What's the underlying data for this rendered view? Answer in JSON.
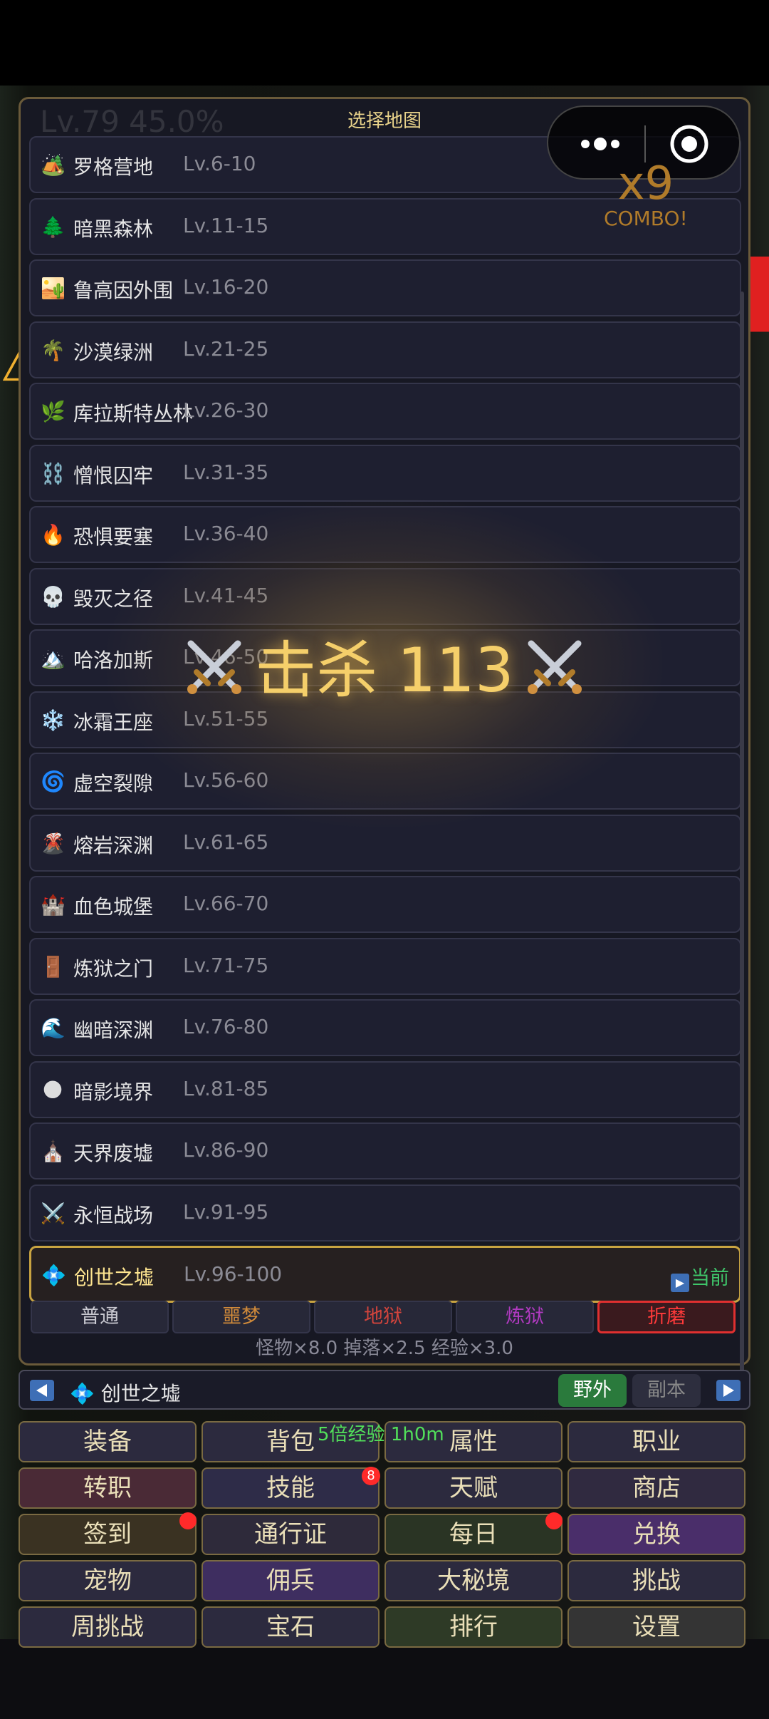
{
  "overlay": {
    "faint_level": "Lv.79 45.0%",
    "combo_count": "x9",
    "combo_label": "COMBO!",
    "kill_banner": "击杀 113"
  },
  "panel": {
    "title": "选择地图",
    "maps": [
      {
        "icon": "🏕️",
        "name": "罗格营地",
        "level": "Lv.6-10"
      },
      {
        "icon": "🌲",
        "name": "暗黑森林",
        "level": "Lv.11-15"
      },
      {
        "icon": "🏜️",
        "name": "鲁高因外围",
        "level": "Lv.16-20"
      },
      {
        "icon": "🌴",
        "name": "沙漠绿洲",
        "level": "Lv.21-25"
      },
      {
        "icon": "🌿",
        "name": "库拉斯特丛林",
        "level": "Lv.26-30"
      },
      {
        "icon": "⛓️",
        "name": "憎恨囚牢",
        "level": "Lv.31-35"
      },
      {
        "icon": "🔥",
        "name": "恐惧要塞",
        "level": "Lv.36-40"
      },
      {
        "icon": "💀",
        "name": "毁灭之径",
        "level": "Lv.41-45"
      },
      {
        "icon": "🏔️",
        "name": "哈洛加斯",
        "level": "Lv.46-50"
      },
      {
        "icon": "❄️",
        "name": "冰霜王座",
        "level": "Lv.51-55"
      },
      {
        "icon": "🌀",
        "name": "虚空裂隙",
        "level": "Lv.56-60"
      },
      {
        "icon": "🌋",
        "name": "熔岩深渊",
        "level": "Lv.61-65"
      },
      {
        "icon": "🏰",
        "name": "血色城堡",
        "level": "Lv.66-70"
      },
      {
        "icon": "🚪",
        "name": "炼狱之门",
        "level": "Lv.71-75"
      },
      {
        "icon": "🌊",
        "name": "幽暗深渊",
        "level": "Lv.76-80"
      },
      {
        "icon": "🌑",
        "name": "暗影境界",
        "level": "Lv.81-85"
      },
      {
        "icon": "⛪",
        "name": "天界废墟",
        "level": "Lv.86-90"
      },
      {
        "icon": "⚔️",
        "name": "永恒战场",
        "level": "Lv.91-95"
      },
      {
        "icon": "💠",
        "name": "创世之墟",
        "level": "Lv.96-100"
      }
    ],
    "current_label": "当前",
    "difficulties": [
      {
        "label": "普通",
        "color": "#c8c8d0"
      },
      {
        "label": "噩梦",
        "color": "#d08a3a"
      },
      {
        "label": "地狱",
        "color": "#d2443c"
      },
      {
        "label": "炼狱",
        "color": "#b03ac0"
      },
      {
        "label": "折磨",
        "color": "#ff3a3a"
      }
    ],
    "stats": "怪物×8.0  掉落×2.5  经验×3.0"
  },
  "map_bar": {
    "current_map_icon": "💠",
    "current_map": "创世之墟",
    "wild": "野外",
    "dungeon": "副本"
  },
  "menu": {
    "exp_buff": "5倍经验 1h0m",
    "skills_badge": "8",
    "buttons": [
      {
        "label": "装备",
        "bg": "#2c2a3e"
      },
      {
        "label": "背包",
        "bg": "#2c2a3e"
      },
      {
        "label": "属性",
        "bg": "#2c2a3e"
      },
      {
        "label": "职业",
        "bg": "#2c2a3e"
      },
      {
        "label": "转职",
        "bg": "#4a2a36"
      },
      {
        "label": "技能",
        "bg": "#2e2c48"
      },
      {
        "label": "天赋",
        "bg": "#2c2a3e"
      },
      {
        "label": "商店",
        "bg": "#302a40"
      },
      {
        "label": "签到",
        "bg": "#3a3222"
      },
      {
        "label": "通行证",
        "bg": "#2e2a3a"
      },
      {
        "label": "每日",
        "bg": "#2a3424"
      },
      {
        "label": "兑换",
        "bg": "#4a2e6a"
      },
      {
        "label": "宠物",
        "bg": "#2c2a3e"
      },
      {
        "label": "佣兵",
        "bg": "#3e2e60"
      },
      {
        "label": "大秘境",
        "bg": "#2c2a3e"
      },
      {
        "label": "挑战",
        "bg": "#2c2a3e"
      },
      {
        "label": "周挑战",
        "bg": "#2c2a3e"
      },
      {
        "label": "宝石",
        "bg": "#2c2a3e"
      },
      {
        "label": "排行",
        "bg": "#2e3a26"
      },
      {
        "label": "设置",
        "bg": "#343434"
      }
    ]
  }
}
